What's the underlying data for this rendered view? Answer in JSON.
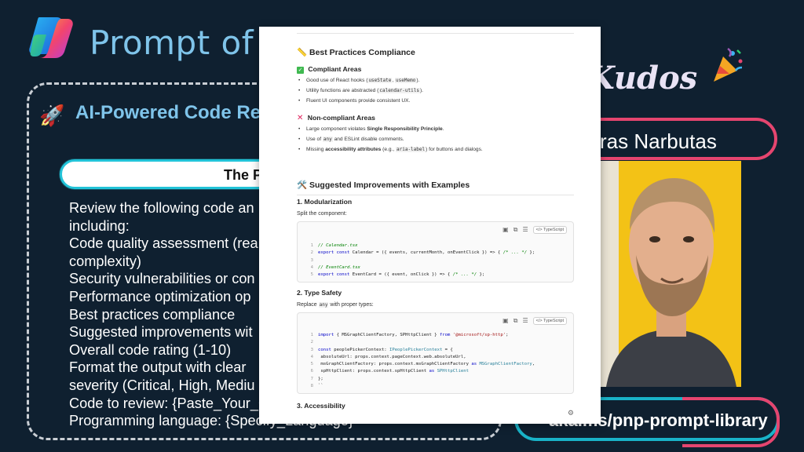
{
  "slide": {
    "title": "Prompt of th",
    "panel_title": "AI-Powered Code Rev",
    "rocket_icon": "rocket-icon",
    "prompt_pill": "The P",
    "prompt_lines": [
      "Review the following code an",
      "including:",
      "Code quality assessment (rea",
      "complexity)",
      "Security vulnerabilities or con",
      "Performance optimization op",
      "Best practices compliance",
      "Suggested improvements wit",
      "Overall code rating (1-10)",
      "Format the output with clear",
      "severity (Critical, High, Mediu",
      "Code to review: {Paste_Your_C",
      "Programming language: {Specify_Language}"
    ],
    "kudos": "Kudos",
    "presenter_name": "ras Narbutas",
    "url": "aka.ms/pnp-prompt-library"
  },
  "doc": {
    "best_practices_heading": "Best Practices Compliance",
    "compliant": {
      "heading": "Compliant Areas",
      "items": [
        [
          "Good use of React hooks (",
          "useState",
          ", ",
          "useMemo",
          ")."
        ],
        [
          "Utility functions are abstracted (",
          "calendar-utils",
          ")."
        ],
        [
          "Fluent UI components provide consistent UX."
        ]
      ]
    },
    "non_compliant": {
      "heading": "Non-compliant Areas",
      "item1_pre": "Large component violates ",
      "item1_bold": "Single Responsibility Principle",
      "item1_post": ".",
      "item2_pre": "Use of ",
      "item2_code": "any",
      "item2_post": " and ESLint disable comments.",
      "item3_pre": "Missing ",
      "item3_bold": "accessibility attributes",
      "item3_mid": " (e.g., ",
      "item3_code": "aria-label",
      "item3_post": ") for buttons and dialogs."
    },
    "suggested_heading": "Suggested Improvements with Examples",
    "section1": {
      "heading": "1. Modularization",
      "desc": "Split the component:",
      "lang": "TypeScript",
      "lines": [
        {
          "n": "1",
          "parts": [
            [
              "cm",
              "// Calendar.tsx"
            ]
          ]
        },
        {
          "n": "2",
          "parts": [
            [
              "kw",
              "export const "
            ],
            [
              "",
              "Calendar = ({ events, currentMonth, onEventClick }) => { "
            ],
            [
              "cm",
              "/* ... */"
            ],
            [
              "",
              " };"
            ]
          ]
        },
        {
          "n": "3",
          "parts": [
            [
              "",
              ""
            ]
          ]
        },
        {
          "n": "4",
          "parts": [
            [
              "cm",
              "// EventCard.tsx"
            ]
          ]
        },
        {
          "n": "5",
          "parts": [
            [
              "kw",
              "export const "
            ],
            [
              "",
              "EventCard = ({ event, onClick }) => { "
            ],
            [
              "cm",
              "/* ... */"
            ],
            [
              "",
              " };"
            ]
          ]
        }
      ]
    },
    "section2": {
      "heading": "2. Type Safety",
      "desc_pre": "Replace ",
      "desc_code": "any",
      "desc_post": " with proper types:",
      "lang": "TypeScript",
      "lines": [
        {
          "n": "1",
          "parts": [
            [
              "kw",
              "import "
            ],
            [
              "",
              "{ MSGraphClientFactory, SPHttpClient } "
            ],
            [
              "kw",
              "from "
            ],
            [
              "st",
              "'@microsoft/sp-http'"
            ],
            [
              "",
              ";"
            ]
          ]
        },
        {
          "n": "2",
          "parts": [
            [
              "",
              ""
            ]
          ]
        },
        {
          "n": "3",
          "parts": [
            [
              "kw",
              "const "
            ],
            [
              "",
              "peoplePickerContext: "
            ],
            [
              "ty",
              "IPeoplePickerContext"
            ],
            [
              "",
              " = {"
            ]
          ]
        },
        {
          "n": "4",
          "parts": [
            [
              "",
              "  absoluteUrl: props.context.pageContext.web.absoluteUrl,"
            ]
          ]
        },
        {
          "n": "5",
          "parts": [
            [
              "",
              "  msGraphClientFactory: props.context.msGraphClientFactory "
            ],
            [
              "kw",
              "as "
            ],
            [
              "ty",
              "MSGraphClientFactory"
            ],
            [
              "",
              ","
            ]
          ]
        },
        {
          "n": "6",
          "parts": [
            [
              "",
              "  spHttpClient: props.context.spHttpClient "
            ],
            [
              "kw",
              "as "
            ],
            [
              "ty",
              "SPHttpClient"
            ]
          ]
        },
        {
          "n": "7",
          "parts": [
            [
              "",
              "};"
            ]
          ]
        },
        {
          "n": "8",
          "parts": [
            [
              "",
              "``"
            ]
          ]
        }
      ]
    },
    "section3_heading": "3. Accessibility"
  },
  "colors": {
    "slide_bg": "#0f2030",
    "accent_blue": "#7fc4ea",
    "pill_cyan": "#22c3d8",
    "pill_pink": "#e5456f",
    "photo_bg": "#f3c216"
  }
}
